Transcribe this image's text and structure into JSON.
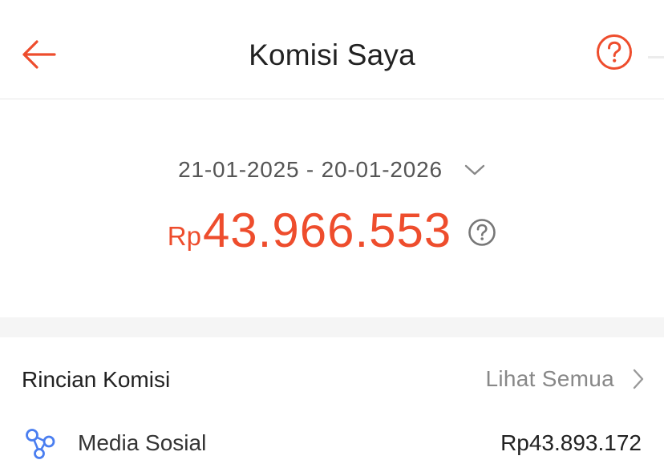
{
  "header": {
    "title": "Komisi Saya",
    "back_icon": "arrow-left-icon",
    "help_icon": "question-circle-icon"
  },
  "summary": {
    "date_range": "21-01-2025 - 20-01-2026",
    "currency": "Rp",
    "amount": "43.966.553",
    "amount_help_icon": "question-circle-icon"
  },
  "breakdown": {
    "title": "Rincian Komisi",
    "see_all_label": "Lihat Semua",
    "items": [
      {
        "label": "Media Sosial",
        "value": "Rp43.893.172",
        "icon": "share-nodes-icon"
      }
    ]
  },
  "colors": {
    "accent": "#ee4d2d",
    "icon_blue": "#4a7ef0",
    "muted_text": "#888888",
    "section_gap": "#f5f5f5"
  }
}
